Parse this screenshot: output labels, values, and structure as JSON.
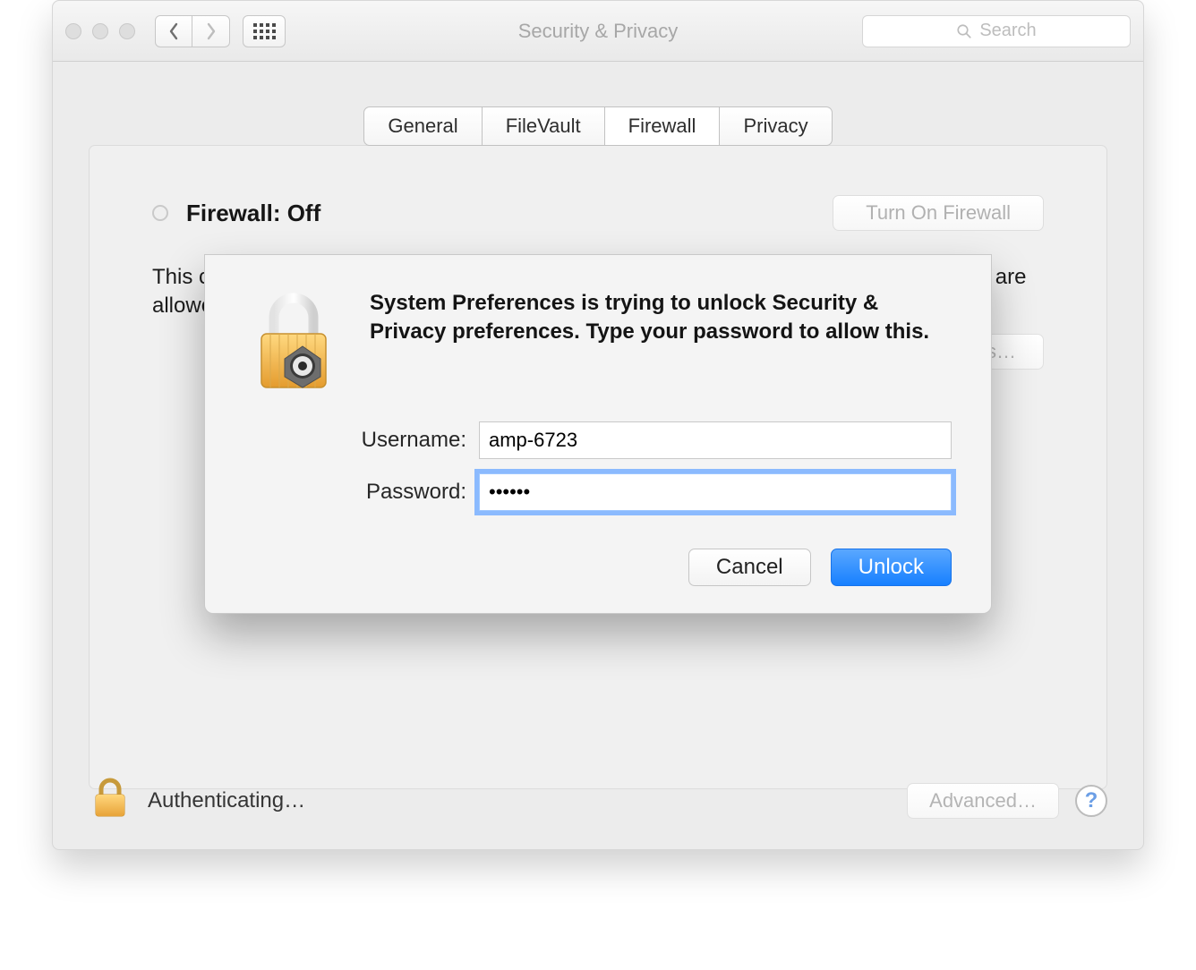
{
  "window": {
    "title": "Security & Privacy",
    "search_placeholder": "Search"
  },
  "tabs": [
    "General",
    "FileVault",
    "Firewall",
    "Privacy"
  ],
  "active_tab": "Firewall",
  "firewall": {
    "status_label": "Firewall: Off",
    "turn_on_label": "Turn On Firewall",
    "description": "This computer’s firewall is currently turned off. All incoming connections to this computer are allowed.",
    "options_label": "Firewall Options…"
  },
  "footer": {
    "status_text": "Authenticating…",
    "advanced_label": "Advanced…",
    "help_label": "?"
  },
  "dialog": {
    "message": "System Preferences is trying to unlock Security & Privacy preferences. Type your password to allow this.",
    "username_label": "Username:",
    "password_label": "Password:",
    "username_value": "amp-6723",
    "password_value": "••••••",
    "cancel_label": "Cancel",
    "unlock_label": "Unlock"
  }
}
